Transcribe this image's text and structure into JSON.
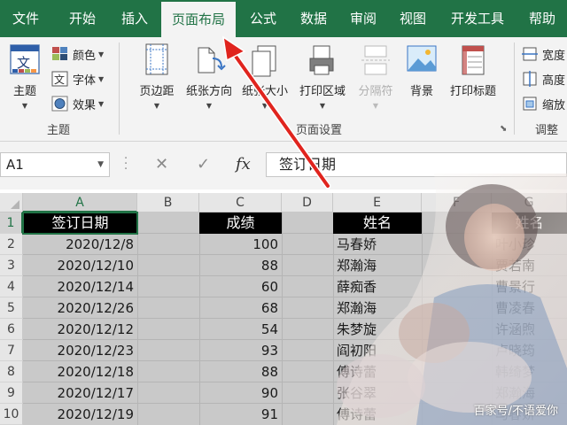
{
  "tabs": [
    {
      "label": "文件",
      "active": false
    },
    {
      "label": "开始",
      "active": false
    },
    {
      "label": "插入",
      "active": false
    },
    {
      "label": "页面布局",
      "active": true
    },
    {
      "label": "公式",
      "active": false
    },
    {
      "label": "数据",
      "active": false
    },
    {
      "label": "审阅",
      "active": false
    },
    {
      "label": "视图",
      "active": false
    },
    {
      "label": "开发工具",
      "active": false
    },
    {
      "label": "帮助",
      "active": false
    }
  ],
  "ribbon": {
    "theme_group": {
      "themes_label": "主题",
      "colors_label": "颜色",
      "fonts_label": "字体",
      "effects_label": "效果",
      "group_label": "主题"
    },
    "page_setup": {
      "margins_label": "页边距",
      "orientation_label": "纸张方向",
      "size_label": "纸张大小",
      "print_area_label": "打印区域",
      "breaks_label": "分隔符",
      "background_label": "背景",
      "print_titles_label": "打印标题",
      "group_label": "页面设置"
    },
    "scale_group": {
      "width_label": "宽度",
      "height_label": "高度",
      "scale_label": "缩放",
      "group_label": "调整"
    }
  },
  "formula_bar": {
    "name_box": "A1",
    "cancel_icon": "✕",
    "enter_icon": "✓",
    "fx_label": "fx",
    "content": "签订日期"
  },
  "columns": [
    "A",
    "B",
    "C",
    "D",
    "E",
    "F",
    "G"
  ],
  "rows": [
    "1",
    "2",
    "3",
    "4",
    "5",
    "6",
    "7",
    "8",
    "9",
    "10"
  ],
  "sheet": {
    "col_a_header": "签订日期",
    "col_c_header": "成绩",
    "col_e_header": "姓名",
    "col_g_header": "姓名",
    "dates": [
      "2020/12/8",
      "2020/12/10",
      "2020/12/14",
      "2020/12/26",
      "2020/12/12",
      "2020/12/23",
      "2020/12/18",
      "2020/12/17",
      "2020/12/19"
    ],
    "scores": [
      "100",
      "88",
      "60",
      "68",
      "54",
      "93",
      "88",
      "90",
      "91"
    ],
    "names_e": [
      "马春娇",
      "郑瀚海",
      "薛痴香",
      "郑瀚海",
      "朱梦旋",
      "阎初阳",
      "傅诗蕾",
      "张谷翠",
      "傅诗蕾"
    ],
    "names_g": [
      "叶小珍",
      "贾若南",
      "曹景行",
      "曹凌春",
      "许涵煦",
      "卢晓筠",
      "韩绮梦",
      "郑瀚海",
      "马春娇"
    ]
  },
  "watermark": "百家号/不语爱你",
  "colors": {
    "accent": "#217346",
    "header_fill": "#000000",
    "arrow": "#e0241e"
  }
}
